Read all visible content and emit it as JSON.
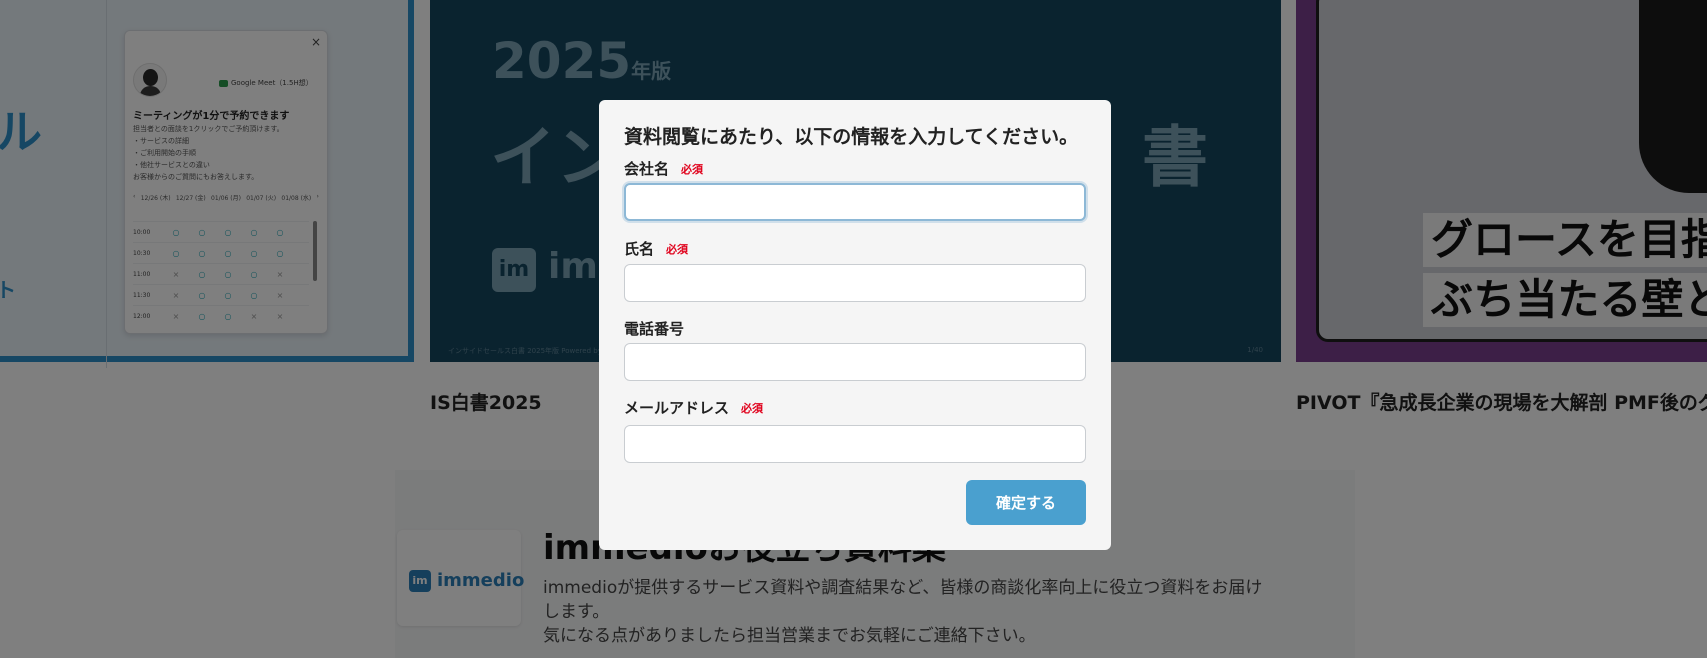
{
  "background": {
    "left_card": {
      "accent_letter": "ル",
      "accent_link": "ト",
      "widget": {
        "close": "×",
        "meet_label": "Google Meet（1.5H想）",
        "title": "ミーティングが1分で予約できます",
        "desc_lines": [
          "担当者との面談を1クリックでご予約頂けます。",
          "・サービスの詳細",
          "・ご利用開始の手順",
          "・他社サービスとの違い",
          "お客様からのご質問にもお答えします。"
        ],
        "days": [
          "‹",
          "12/26\n(木)",
          "12/27\n(金)",
          "01/06\n(月)",
          "01/07\n(火)",
          "01/08\n(水)",
          "›"
        ],
        "rows": [
          {
            "time": "10:00",
            "cells": [
              "○",
              "○",
              "○",
              "○",
              "○"
            ]
          },
          {
            "time": "10:30",
            "cells": [
              "○",
              "○",
              "○",
              "○",
              "○"
            ]
          },
          {
            "time": "11:00",
            "cells": [
              "×",
              "○",
              "○",
              "○",
              "×"
            ]
          },
          {
            "time": "11:30",
            "cells": [
              "×",
              "○",
              "○",
              "○",
              "×"
            ]
          },
          {
            "time": "12:00",
            "cells": [
              "×",
              "○",
              "○",
              "×",
              "×"
            ]
          }
        ]
      }
    },
    "middle_card": {
      "year": "2025",
      "year_suffix": "年版",
      "headline_start": "イン",
      "headline_end": "書",
      "logo_mark": "im",
      "logo_text": "imm",
      "footer_left": "インサイドセールス白書 2025年版 Powered by immedio",
      "footer_right": "1/40"
    },
    "right_card": {
      "caption_1": "グロースを目指",
      "caption_2": "ぶち当たる壁と"
    },
    "captions": {
      "middle": "IS白書2025",
      "right": "PIVOT『急成長企業の現場を大解剖 PMF後のグロ"
    },
    "bottom": {
      "logo_mark": "im",
      "logo_name": "immedio",
      "title": "immedioお役立ち資料集",
      "desc_1": "immedioが提供するサービス資料や調査結果など、皆様の商談化率向上に役立つ資料をお届けします。",
      "desc_2": "気になる点がありましたら担当営業までお気軽にご連絡下さい。"
    }
  },
  "modal": {
    "title": "資料閲覧にあたり、以下の情報を入力してください。",
    "fields": [
      {
        "label": "会社名",
        "required": "必須",
        "value": "",
        "placeholder": ""
      },
      {
        "label": "氏名",
        "required": "必須",
        "value": "",
        "placeholder": ""
      },
      {
        "label": "電話番号",
        "required": "",
        "value": "",
        "placeholder": ""
      },
      {
        "label": "メールアドレス",
        "required": "必須",
        "value": "",
        "placeholder": ""
      }
    ],
    "submit_label": "確定する"
  },
  "colors": {
    "overlay": "rgba(0,0,0,0.5)",
    "modal_bg": "#f5f5f5",
    "required": "#e0001b",
    "submit_bg": "#4aa0cf",
    "focus_ring": "#8db8d6"
  }
}
